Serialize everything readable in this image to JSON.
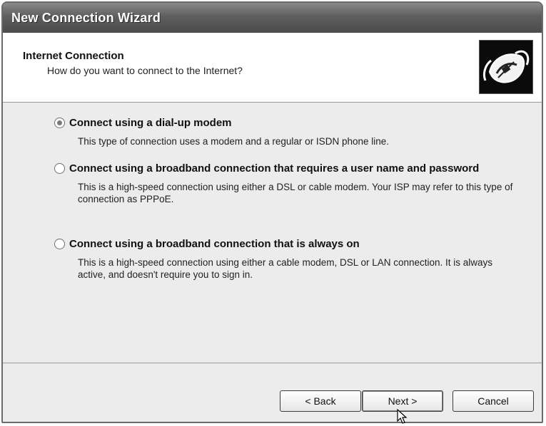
{
  "window": {
    "title": "New Connection Wizard"
  },
  "header": {
    "title": "Internet Connection",
    "subtitle": "How do you want to connect to the Internet?",
    "icon": "network-connection-icon"
  },
  "options": [
    {
      "label": "Connect using a dial-up modem",
      "description": "This type of connection uses a modem and a regular or ISDN phone line.",
      "selected": true
    },
    {
      "label": "Connect using a broadband connection that requires a user name and password",
      "description": "This is a high-speed connection using either a DSL or cable modem. Your ISP may refer to this type of connection as PPPoE.",
      "selected": false
    },
    {
      "label": "Connect using a broadband connection that is always on",
      "description": "This is a high-speed connection using either a cable modem, DSL or LAN connection. It is always active, and doesn't require you to sign in.",
      "selected": false
    }
  ],
  "buttons": {
    "back": "< Back",
    "next": "Next >",
    "cancel": "Cancel"
  }
}
